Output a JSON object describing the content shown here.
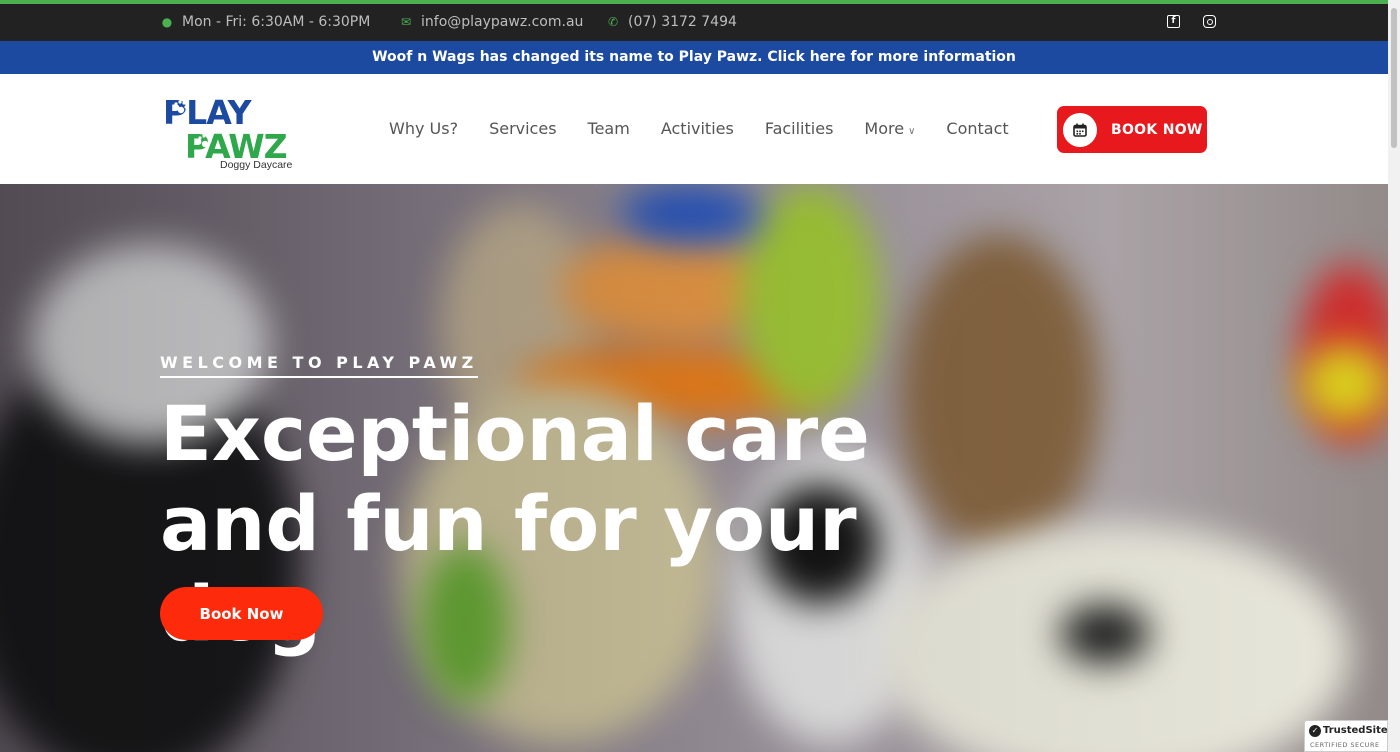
{
  "topbar": {
    "hours": "Mon - Fri: 6:30AM - 6:30PM",
    "email": "info@playpawz.com.au",
    "phone": "(07) 3172 7494",
    "social": [
      "facebook-icon",
      "instagram-icon"
    ]
  },
  "notice": {
    "text": "Woof n Wags has changed its name to Play Pawz. Click here for more information"
  },
  "logo": {
    "line1": "PLAY",
    "line2": "PAWZ",
    "tagline": "Doggy Daycare",
    "colors": {
      "blue": "#1b4aa0",
      "green": "#2ea84a"
    }
  },
  "nav": {
    "items": [
      "Why Us?",
      "Services",
      "Team",
      "Activities",
      "Facilities",
      "More",
      "Contact"
    ],
    "book_label": "BOOK NOW"
  },
  "hero": {
    "eyebrow": "WELCOME TO PLAY PAWZ",
    "headline": "Exceptional care and fun for your dog",
    "button_label": "Book Now"
  },
  "badge": {
    "title": "TrustedSite",
    "subtitle": "CERTIFIED SECURE"
  },
  "colors": {
    "accent_red": "#e8191c",
    "hero_button": "#fd2a0c",
    "notice_bg": "#1b4aa0",
    "topbar_bg": "#222222",
    "topbar_icon": "#4caf50"
  }
}
